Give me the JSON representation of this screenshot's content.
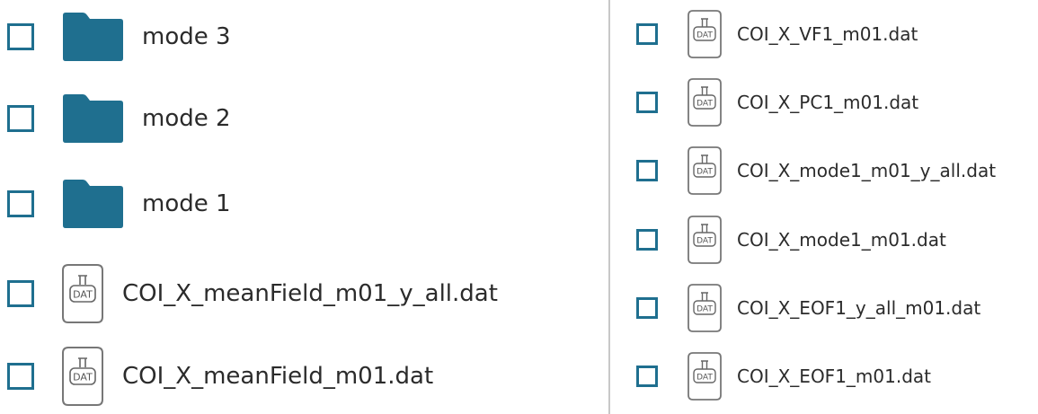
{
  "colors": {
    "accent": "#1f6f8f",
    "folder": "#1f6f8f",
    "text": "#2b2b2b",
    "file_icon_stroke": "#777777",
    "divider": "#c8c8c8"
  },
  "icons": {
    "folder": "folder-icon",
    "dat_file": "dat-file-icon",
    "dat_badge_text": "DAT"
  },
  "left_items": [
    {
      "type": "folder",
      "name": "mode 3",
      "checked": false
    },
    {
      "type": "folder",
      "name": "mode 2",
      "checked": false
    },
    {
      "type": "folder",
      "name": "mode 1",
      "checked": false
    },
    {
      "type": "file",
      "name": "COI_X_meanField_m01_y_all.dat",
      "checked": false
    },
    {
      "type": "file",
      "name": "COI_X_meanField_m01.dat",
      "checked": false
    }
  ],
  "right_items": [
    {
      "type": "file",
      "name": "COI_X_VF1_m01.dat",
      "checked": false
    },
    {
      "type": "file",
      "name": "COI_X_PC1_m01.dat",
      "checked": false
    },
    {
      "type": "file",
      "name": "COI_X_mode1_m01_y_all.dat",
      "checked": false
    },
    {
      "type": "file",
      "name": "COI_X_mode1_m01.dat",
      "checked": false
    },
    {
      "type": "file",
      "name": "COI_X_EOF1_y_all_m01.dat",
      "checked": false
    },
    {
      "type": "file",
      "name": "COI_X_EOF1_m01.dat",
      "checked": false
    }
  ]
}
